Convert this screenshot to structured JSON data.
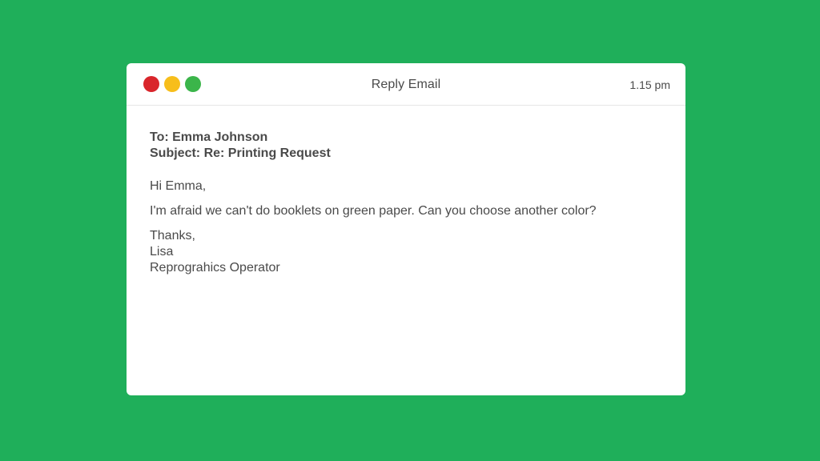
{
  "window": {
    "title": "Reply Email",
    "time": "1.15 pm",
    "controls": {
      "close_color": "#d9252b",
      "minimize_color": "#f7be1b",
      "maximize_color": "#3bb54a"
    }
  },
  "email": {
    "to": "To: Emma Johnson",
    "subject": "Subject: Re: Printing Request",
    "greeting": "Hi Emma,",
    "body": "I'm afraid we can't do booklets on green paper. Can you choose another color?",
    "signoff": "Thanks,",
    "name": "Lisa",
    "role": "Reprograhics Operator"
  },
  "colors": {
    "background": "#1faf5a",
    "window": "#ffffff",
    "text": "#4a4a4a"
  }
}
